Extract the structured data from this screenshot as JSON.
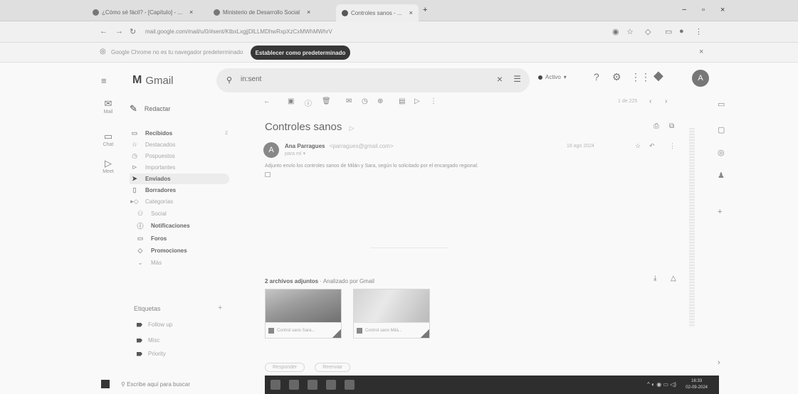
{
  "browser": {
    "tabs": [
      {
        "label": "¿Cómo sé fácil? - [Capítulo] - ...",
        "icon": "youtube-icon"
      },
      {
        "label": "Ministerio de Desarrollo Social",
        "icon": "globe-icon"
      },
      {
        "label": "Controles sanos - ...",
        "icon": "gmail-icon"
      }
    ],
    "url": "mail.google.com/mail/u/0/#sent/KtbxLxgjjDlLLMDhwRxpXzCxMWhMWhrV",
    "info_text": "Google Chrome no es tu navegador predeterminado",
    "set_default_label": "Establecer como predeterminado"
  },
  "gmail": {
    "logo": "Gmail",
    "search_value": "in:sent",
    "status": "Activo",
    "avatar": "A",
    "compose": "Redactar",
    "rail": [
      {
        "label": "Mail",
        "icon": "mail-icon"
      },
      {
        "label": "Chat",
        "icon": "chat-icon"
      },
      {
        "label": "Meet",
        "icon": "meet-icon"
      }
    ],
    "nav": [
      {
        "label": "Recibidos",
        "count": "2",
        "bold": true
      },
      {
        "label": "Destacados",
        "count": ""
      },
      {
        "label": "Pospuestos",
        "count": ""
      },
      {
        "label": "Importantes",
        "count": ""
      },
      {
        "label": "Enviados",
        "count": "",
        "bold": true,
        "selected": true
      },
      {
        "label": "Borradores",
        "count": "",
        "bold": true
      },
      {
        "label": "Categorías",
        "count": ""
      },
      {
        "label": "Social",
        "count": ""
      },
      {
        "label": "Notificaciones",
        "count": "",
        "bold": true
      },
      {
        "label": "Foros",
        "count": "",
        "bold": true
      },
      {
        "label": "Promociones",
        "count": "",
        "bold": true
      },
      {
        "label": "Más",
        "count": ""
      }
    ],
    "labels_title": "Etiquetas",
    "labels": [
      "Follow up",
      "Misc",
      "Priority"
    ],
    "message": {
      "subject": "Controles sanos",
      "sender": "Ana Parragues",
      "sender_email": "<parragues@gmail.com>",
      "recipient": "para mí",
      "date": "18 ago 2024",
      "body": "Adjunto envío los controles sanos de Milán y Sara, según lo solicitado por el encargado regional.",
      "attach_count": "2 archivos adjuntos",
      "attach_scan": "Analizado por Gmail",
      "attachments": [
        {
          "name": "Control sano Sara..."
        },
        {
          "name": "Control sano Milá..."
        }
      ],
      "reply": "Responder",
      "forward": "Reenviar"
    },
    "pager": "1 de 225"
  },
  "taskbar": {
    "search": "Escribe aquí para buscar",
    "time": "16:33",
    "date": "02-09-2024"
  }
}
